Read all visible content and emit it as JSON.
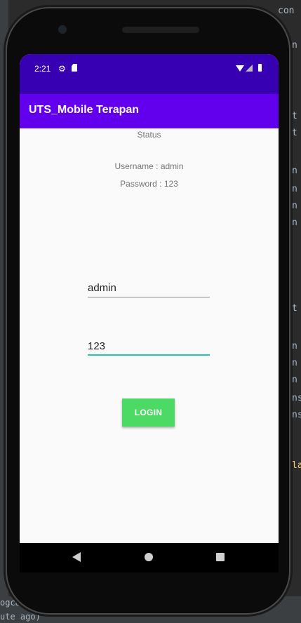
{
  "status_bar": {
    "time": "2:21"
  },
  "app_bar": {
    "title": "UTS_Mobile Terapan"
  },
  "content": {
    "status_label": "Status",
    "username_info": "Username : admin",
    "password_info": "Password : 123"
  },
  "form": {
    "username_value": "admin",
    "password_value": "123",
    "login_label": "LOGIN"
  },
  "ide": {
    "lines": [
      "con",
      "n",
      "t",
      "t",
      "n",
      "n",
      "n",
      "n",
      "t",
      "n",
      "n",
      "n",
      "ns",
      "ns",
      "la"
    ],
    "bottom_text": "ute ago)",
    "logcat": "ogcat"
  },
  "colors": {
    "status_bar": "#3700b3",
    "app_bar": "#6200ee",
    "login_button": "#4cd964",
    "focused_underline": "#26c6b0"
  }
}
